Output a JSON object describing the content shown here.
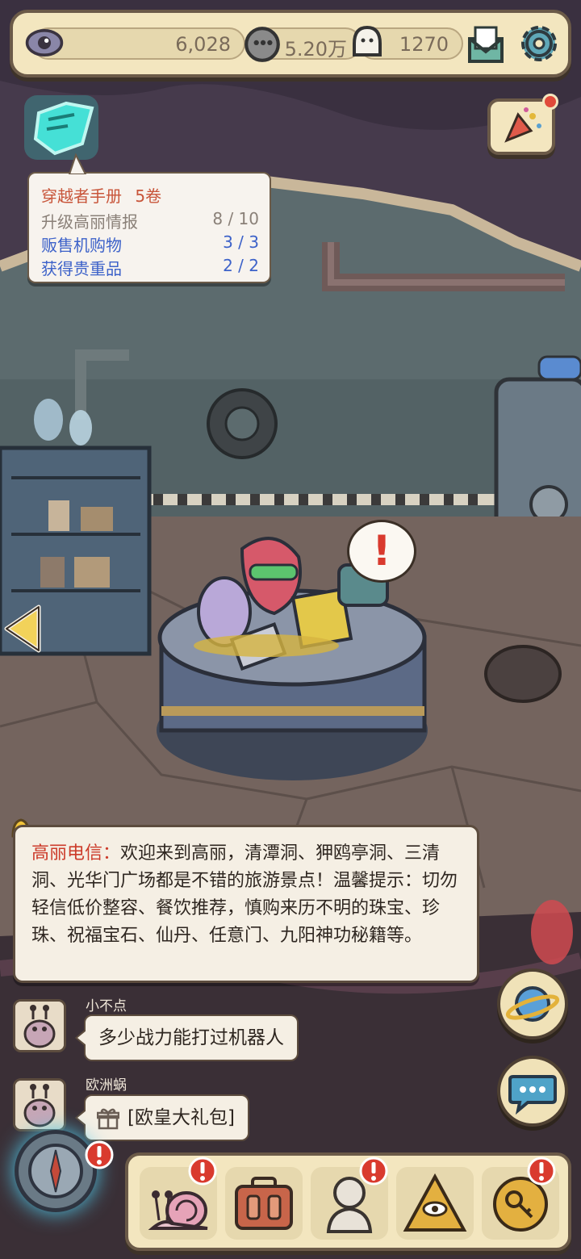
{
  "resources": [
    {
      "icon": "eye-icon",
      "value": "6,028"
    },
    {
      "icon": "gray-gem-icon",
      "value": "5.20万"
    },
    {
      "icon": "ghost-icon",
      "value": "1270"
    }
  ],
  "top_buttons": {
    "mail_icon": "mail-icon",
    "settings_icon": "gear-icon",
    "event_icon": "party-popper-icon"
  },
  "handbook": {
    "title": "穿越者手册",
    "volume": "5卷",
    "tasks": [
      {
        "name": "升级高丽情报",
        "progress": "8 / 10",
        "status": "in-progress"
      },
      {
        "name": "贩售机购物",
        "progress": "3 / 3",
        "status": "complete"
      },
      {
        "name": "获得贵重品",
        "progress": "2 / 2",
        "status": "complete"
      }
    ]
  },
  "announcement": {
    "sender": "高丽电信：",
    "text": "欢迎来到高丽，清潭洞、狎鸥亭洞、三清洞、光华门广场都是不错的旅游景点！温馨提示：切勿轻信低价整容、餐饮推荐，慎购来历不明的珠宝、珍珠、祝福宝石、仙丹、任意门、九阳神功秘籍等。"
  },
  "chat": [
    {
      "name": "小不点",
      "message": "多少战力能打过机器人"
    },
    {
      "name": "欧洲蜗",
      "message": "[欧皇大礼包]",
      "has_gift_icon": true
    }
  ],
  "alert_mark": "!",
  "colors": {
    "panel": "#f3e6bf",
    "border": "#6b5a48",
    "alert_red": "#d93a2e",
    "link_blue": "#3d62c9",
    "title_red": "#c8553a"
  }
}
